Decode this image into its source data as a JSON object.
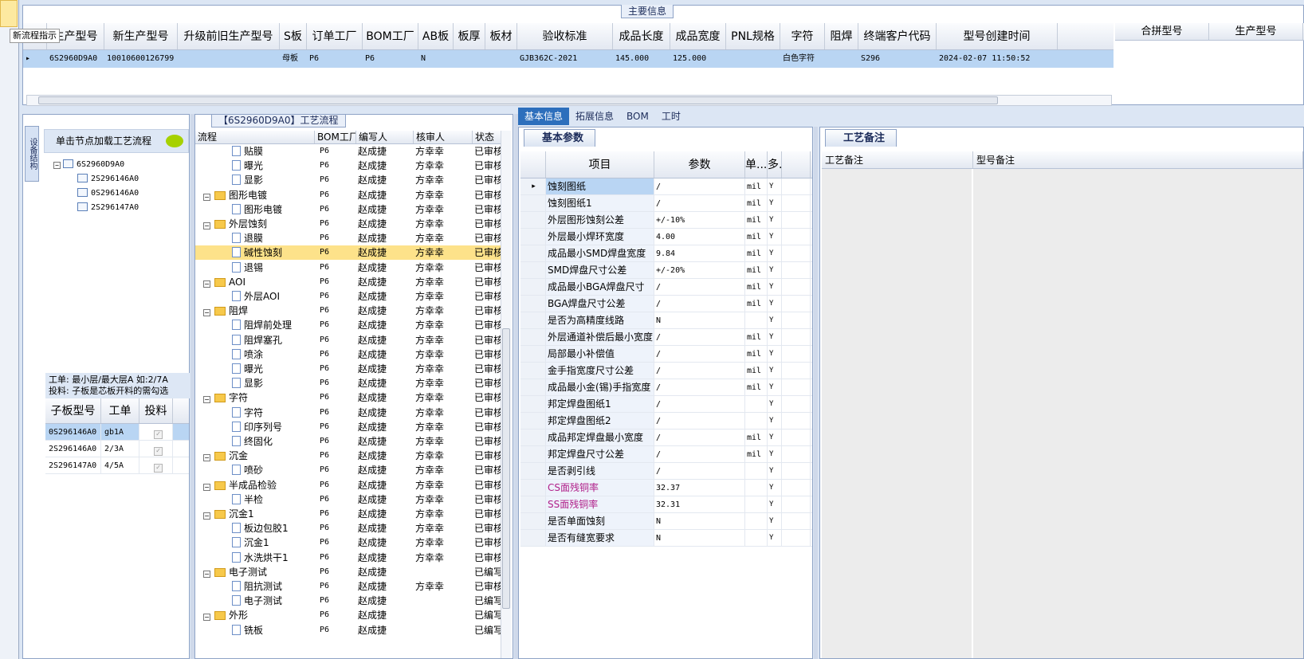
{
  "flow_hint": "新流程指示",
  "main_info": {
    "caption": "主要信息",
    "columns": [
      "生产型号",
      "新生产型号",
      "升级前旧生产型号",
      "S板",
      "订单工厂",
      "BOM工厂",
      "AB板",
      "板厚",
      "板材",
      "验收标准",
      "成品长度",
      "成品宽度",
      "PNL规格",
      "字符",
      "阻焊",
      "终端客户代码",
      "型号创建时间"
    ],
    "row": [
      "6S2960D9A0",
      "10010600126799",
      "",
      "母板",
      "P6",
      "P6",
      "N",
      "",
      "",
      "GJB362C-2021",
      "145.000",
      "125.000",
      "",
      "白色字符",
      "",
      "S296",
      "2024-02-07 11:50:52"
    ],
    "merge_columns": [
      "合拼型号",
      "生产型号"
    ]
  },
  "tree": {
    "side_tab": "设备结构",
    "load_hint": "单击节点加载工艺流程",
    "root": "6S2960D9A0",
    "children": [
      "2S296146A0",
      "0S296146A0",
      "2S296147A0"
    ],
    "info_line1": "工单: 最小层/最大层A 如:2/7A",
    "info_line2": "投料: 子板是芯板开料的需勾选",
    "sub_columns": [
      "子板型号",
      "工单",
      "投料"
    ],
    "sub_rows": [
      {
        "model": "0S296146A0",
        "order": "gb1A"
      },
      {
        "model": "2S296146A0",
        "order": "2/3A"
      },
      {
        "model": "2S296147A0",
        "order": "4/5A"
      }
    ]
  },
  "flow": {
    "caption": "【6S2960D9A0】工艺流程",
    "columns": [
      "流程",
      "BOM工厂",
      "编写人",
      "核审人",
      "状态"
    ],
    "rows": [
      {
        "name": "贴膜",
        "type": "doc",
        "bom": "P6",
        "writer": "赵成捷",
        "reviewer": "方幸幸",
        "status": "已审核"
      },
      {
        "name": "曝光",
        "type": "doc",
        "bom": "P6",
        "writer": "赵成捷",
        "reviewer": "方幸幸",
        "status": "已审核"
      },
      {
        "name": "显影",
        "type": "doc",
        "bom": "P6",
        "writer": "赵成捷",
        "reviewer": "方幸幸",
        "status": "已审核"
      },
      {
        "name": "图形电镀",
        "type": "folder",
        "bom": "P6",
        "writer": "赵成捷",
        "reviewer": "方幸幸",
        "status": "已审核"
      },
      {
        "name": "图形电镀",
        "type": "doc",
        "bom": "P6",
        "writer": "赵成捷",
        "reviewer": "方幸幸",
        "status": "已审核"
      },
      {
        "name": "外层蚀刻",
        "type": "folder",
        "bom": "P6",
        "writer": "赵成捷",
        "reviewer": "方幸幸",
        "status": "已审核"
      },
      {
        "name": "退膜",
        "type": "doc",
        "bom": "P6",
        "writer": "赵成捷",
        "reviewer": "方幸幸",
        "status": "已审核"
      },
      {
        "name": "碱性蚀刻",
        "type": "doc",
        "bom": "P6",
        "writer": "赵成捷",
        "reviewer": "方幸幸",
        "status": "已审核",
        "selected": true
      },
      {
        "name": "退锡",
        "type": "doc",
        "bom": "P6",
        "writer": "赵成捷",
        "reviewer": "方幸幸",
        "status": "已审核"
      },
      {
        "name": "AOI",
        "type": "folder",
        "bom": "P6",
        "writer": "赵成捷",
        "reviewer": "方幸幸",
        "status": "已审核"
      },
      {
        "name": "外层AOI",
        "type": "doc",
        "bom": "P6",
        "writer": "赵成捷",
        "reviewer": "方幸幸",
        "status": "已审核"
      },
      {
        "name": "阻焊",
        "type": "folder",
        "bom": "P6",
        "writer": "赵成捷",
        "reviewer": "方幸幸",
        "status": "已审核"
      },
      {
        "name": "阻焊前处理",
        "type": "doc",
        "bom": "P6",
        "writer": "赵成捷",
        "reviewer": "方幸幸",
        "status": "已审核"
      },
      {
        "name": "阻焊塞孔",
        "type": "doc",
        "bom": "P6",
        "writer": "赵成捷",
        "reviewer": "方幸幸",
        "status": "已审核"
      },
      {
        "name": "喷涂",
        "type": "doc",
        "bom": "P6",
        "writer": "赵成捷",
        "reviewer": "方幸幸",
        "status": "已审核"
      },
      {
        "name": "曝光",
        "type": "doc",
        "bom": "P6",
        "writer": "赵成捷",
        "reviewer": "方幸幸",
        "status": "已审核"
      },
      {
        "name": "显影",
        "type": "doc",
        "bom": "P6",
        "writer": "赵成捷",
        "reviewer": "方幸幸",
        "status": "已审核"
      },
      {
        "name": "字符",
        "type": "folder",
        "bom": "P6",
        "writer": "赵成捷",
        "reviewer": "方幸幸",
        "status": "已审核"
      },
      {
        "name": "字符",
        "type": "doc",
        "bom": "P6",
        "writer": "赵成捷",
        "reviewer": "方幸幸",
        "status": "已审核"
      },
      {
        "name": "印序列号",
        "type": "doc",
        "bom": "P6",
        "writer": "赵成捷",
        "reviewer": "方幸幸",
        "status": "已审核"
      },
      {
        "name": "终固化",
        "type": "doc",
        "bom": "P6",
        "writer": "赵成捷",
        "reviewer": "方幸幸",
        "status": "已审核"
      },
      {
        "name": "沉金",
        "type": "folder",
        "bom": "P6",
        "writer": "赵成捷",
        "reviewer": "方幸幸",
        "status": "已审核"
      },
      {
        "name": "喷砂",
        "type": "doc",
        "bom": "P6",
        "writer": "赵成捷",
        "reviewer": "方幸幸",
        "status": "已审核"
      },
      {
        "name": "半成品检验",
        "type": "folder",
        "bom": "P6",
        "writer": "赵成捷",
        "reviewer": "方幸幸",
        "status": "已审核"
      },
      {
        "name": "半检",
        "type": "doc",
        "bom": "P6",
        "writer": "赵成捷",
        "reviewer": "方幸幸",
        "status": "已审核"
      },
      {
        "name": "沉金1",
        "type": "folder",
        "bom": "P6",
        "writer": "赵成捷",
        "reviewer": "方幸幸",
        "status": "已审核"
      },
      {
        "name": "板边包胶1",
        "type": "doc",
        "bom": "P6",
        "writer": "赵成捷",
        "reviewer": "方幸幸",
        "status": "已审核"
      },
      {
        "name": "沉金1",
        "type": "doc",
        "bom": "P6",
        "writer": "赵成捷",
        "reviewer": "方幸幸",
        "status": "已审核"
      },
      {
        "name": "水洗烘干1",
        "type": "doc",
        "bom": "P6",
        "writer": "赵成捷",
        "reviewer": "方幸幸",
        "status": "已审核"
      },
      {
        "name": "电子测试",
        "type": "folder",
        "bom": "P6",
        "writer": "赵成捷",
        "reviewer": "",
        "status": "已编写"
      },
      {
        "name": "阻抗测试",
        "type": "doc",
        "bom": "P6",
        "writer": "赵成捷",
        "reviewer": "方幸幸",
        "status": "已审核"
      },
      {
        "name": "电子测试",
        "type": "doc",
        "bom": "P6",
        "writer": "赵成捷",
        "reviewer": "",
        "status": "已编写"
      },
      {
        "name": "外形",
        "type": "folder",
        "bom": "P6",
        "writer": "赵成捷",
        "reviewer": "",
        "status": "已编写"
      },
      {
        "name": "铣板",
        "type": "doc",
        "bom": "P6",
        "writer": "赵成捷",
        "reviewer": "",
        "status": "已编写"
      }
    ]
  },
  "detail": {
    "tabs": [
      "基本信息",
      "拓展信息",
      "BOM",
      "工时"
    ],
    "basic_tab": "基本参数",
    "columns": [
      "项目",
      "参数",
      "单...",
      "多..."
    ],
    "rows": [
      {
        "item": "蚀刻图纸",
        "value": "/",
        "unit": "mil",
        "multi": "Y"
      },
      {
        "item": "蚀刻图纸1",
        "value": "/",
        "unit": "mil",
        "multi": "Y"
      },
      {
        "item": "外层图形蚀刻公差",
        "value": "+/-10%",
        "unit": "mil",
        "multi": "Y"
      },
      {
        "item": "外层最小焊环宽度",
        "value": "4.00",
        "unit": "mil",
        "multi": "Y"
      },
      {
        "item": "成品最小SMD焊盘宽度",
        "value": "9.84",
        "unit": "mil",
        "multi": "Y"
      },
      {
        "item": "SMD焊盘尺寸公差",
        "value": "+/-20%",
        "unit": "mil",
        "multi": "Y"
      },
      {
        "item": "成品最小BGA焊盘尺寸",
        "value": "/",
        "unit": "mil",
        "multi": "Y"
      },
      {
        "item": "BGA焊盘尺寸公差",
        "value": "/",
        "unit": "mil",
        "multi": "Y"
      },
      {
        "item": "是否为高精度线路",
        "value": "N",
        "unit": "",
        "multi": "Y"
      },
      {
        "item": "外层通道补偿后最小宽度",
        "value": "/",
        "unit": "mil",
        "multi": "Y"
      },
      {
        "item": "局部最小补偿值",
        "value": "/",
        "unit": "mil",
        "multi": "Y"
      },
      {
        "item": "金手指宽度尺寸公差",
        "value": "/",
        "unit": "mil",
        "multi": "Y"
      },
      {
        "item": "成品最小金(锡)手指宽度",
        "value": "/",
        "unit": "mil",
        "multi": "Y"
      },
      {
        "item": "邦定焊盘图纸1",
        "value": "/",
        "unit": "",
        "multi": "Y"
      },
      {
        "item": "邦定焊盘图纸2",
        "value": "/",
        "unit": "",
        "multi": "Y"
      },
      {
        "item": "成品邦定焊盘最小宽度",
        "value": "/",
        "unit": "mil",
        "multi": "Y"
      },
      {
        "item": "邦定焊盘尺寸公差",
        "value": "/",
        "unit": "mil",
        "multi": "Y"
      },
      {
        "item": "是否剥引线",
        "value": "/",
        "unit": "",
        "multi": "Y"
      },
      {
        "item": "CS面残铜率",
        "value": "32.37",
        "unit": "",
        "multi": "Y",
        "pink": true
      },
      {
        "item": "SS面残铜率",
        "value": "32.31",
        "unit": "",
        "multi": "Y",
        "pink": true
      },
      {
        "item": "是否单面蚀刻",
        "value": "N",
        "unit": "",
        "multi": "Y"
      },
      {
        "item": "是否有缝宽要求",
        "value": "N",
        "unit": "",
        "multi": "Y"
      }
    ],
    "remark_tab": "工艺备注",
    "remark_columns": [
      "工艺备注",
      "型号备注"
    ]
  }
}
